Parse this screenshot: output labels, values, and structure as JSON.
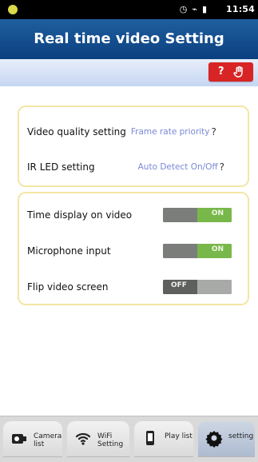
{
  "status_bar": {
    "time": "11:54"
  },
  "header": {
    "title": "Real time video Setting"
  },
  "help_button": {
    "label": "?"
  },
  "settings": {
    "video_quality_label": "Video quality setting",
    "video_quality_value": "Frame rate priority",
    "ir_led_label": "IR LED setting",
    "ir_led_value": "Auto Detect On/Off",
    "help_mark": "?"
  },
  "toggles": {
    "time_display_label": "Time display on video",
    "time_display_state": "ON",
    "microphone_label": "Microphone input",
    "microphone_state": "ON",
    "flip_label": "Flip video screen",
    "flip_state": "OFF"
  },
  "bottom_tabs": {
    "camera_list": "Camera list",
    "wifi_setting": "WiFi Setting",
    "play_list": "Play list",
    "setting": "setting"
  },
  "colors": {
    "header_blue": "#0b3f7f",
    "help_red": "#d82424",
    "toggle_green": "#78b84a",
    "card_border": "#f3e6a6",
    "value_purple": "#7b88d6"
  },
  "icons": [
    "android-icon",
    "wifi-icon",
    "battery-icon",
    "hand-icon",
    "camera-list-icon",
    "wifi-setting-icon",
    "play-list-icon",
    "gear-icon"
  ]
}
